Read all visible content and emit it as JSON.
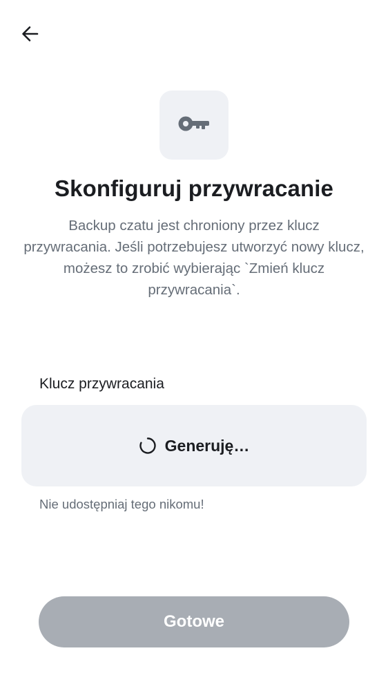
{
  "header": {
    "back_icon": "arrow-left-icon"
  },
  "hero": {
    "icon": "key-icon",
    "title": "Skonfiguruj przywracanie",
    "description": "Backup czatu jest chroniony przez klucz przywracania. Jeśli potrzebujesz utworzyć nowy klucz, możesz to zrobić wybierając `Zmień klucz przywracania`."
  },
  "recovery_key": {
    "label": "Klucz przywracania",
    "status": "Generuję…",
    "spinner_icon": "spinner-icon",
    "warning": "Nie udostępniaj tego nikomu!"
  },
  "footer": {
    "done_label": "Gotowe",
    "done_enabled": false
  },
  "colors": {
    "tile_background": "#eff1f5",
    "text_primary": "#1b1d21",
    "text_secondary": "#656d77",
    "button_disabled": "#a8adb4"
  }
}
